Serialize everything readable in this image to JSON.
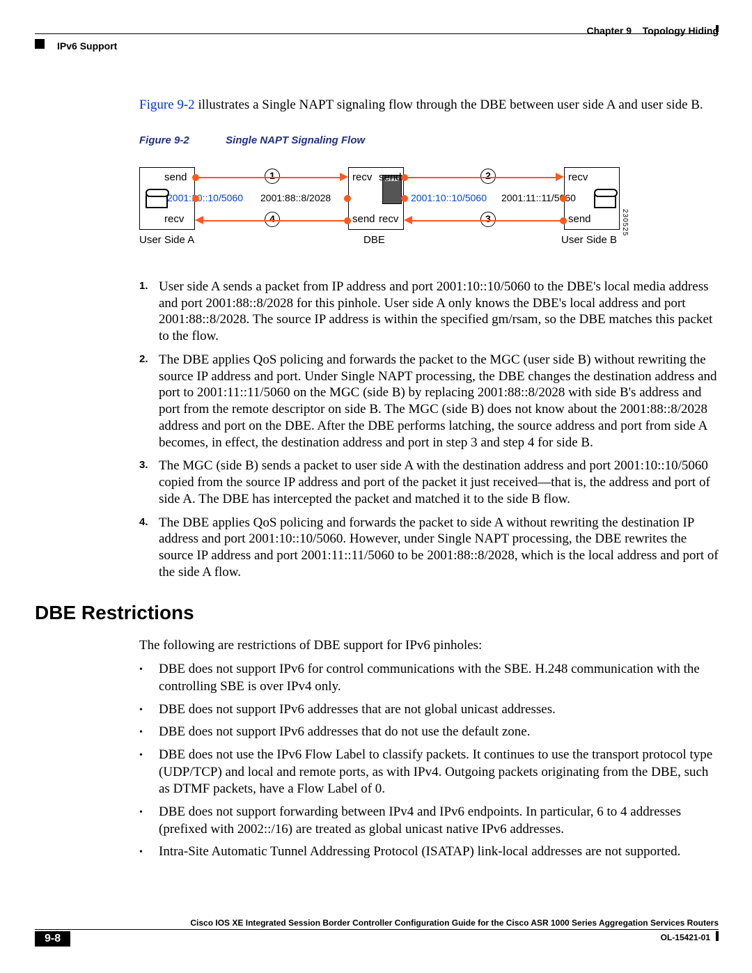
{
  "header": {
    "chapter": "Chapter 9",
    "title": "Topology Hiding",
    "section": "IPv6 Support"
  },
  "intro": {
    "ref": "Figure 9-2",
    "text_after": " illustrates a Single NAPT signaling flow through the DBE between user side A and user side B."
  },
  "figure": {
    "num": "Figure 9-2",
    "title": "Single NAPT Signaling Flow",
    "labels": {
      "send": "send",
      "recv": "recv",
      "userA": "User Side A",
      "dbe": "DBE",
      "userB": "User Side B",
      "addrA": "2001:10::10/5060",
      "addrDBE": "2001:88::8/2028",
      "addrA2": "2001:10::10/5060",
      "addrB": "2001:11::11/5060",
      "imgid": "230525"
    }
  },
  "steps": [
    "User side A sends a packet from IP address and port 2001:10::10/5060 to the DBE's local media address and port 2001:88::8/2028 for this pinhole. User side A only knows the DBE's local address and port 2001:88::8/2028. The source IP address is within the specified gm/rsam, so the DBE matches this packet to the flow.",
    "The DBE applies QoS policing and forwards the packet to the MGC (user side B) without rewriting the source IP address and port. Under Single NAPT processing, the DBE changes the destination address and port to 2001:11::11/5060 on the MGC (side B) by replacing 2001:88::8/2028 with side B's address and port from the remote descriptor on side B. The MGC (side B) does not know about the 2001:88::8/2028 address and port on the DBE. After the DBE performs latching, the source address and port from side A becomes, in effect, the destination address and port in step 3 and step 4 for side B.",
    "The MGC (side B) sends a packet to user side A with the destination address and port 2001:10::10/5060 copied from the source IP address and port of the packet it just received—that is, the address and port of side A. The DBE has intercepted the packet and matched it to the side B flow.",
    "The DBE applies QoS policing and forwards the packet to side A without rewriting the destination IP address and port 2001:10::10/5060. However, under Single NAPT processing, the DBE rewrites the source IP address and port 2001:11::11/5060 to be 2001:88::8/2028, which is the local address and port of the side A flow."
  ],
  "section2": {
    "title": "DBE Restrictions",
    "intro": "The following are restrictions of DBE support for IPv6 pinholes:",
    "bullets": [
      "DBE does not support IPv6 for control communications with the SBE. H.248 communication with the controlling SBE is over IPv4 only.",
      "DBE does not support IPv6 addresses that are not global unicast addresses.",
      "DBE does not support IPv6 addresses that do not use the default zone.",
      "DBE does not use the IPv6 Flow Label to classify packets. It continues to use the transport protocol type (UDP/TCP) and local and remote ports, as with IPv4. Outgoing packets originating from the DBE, such as DTMF packets, have a Flow Label of 0.",
      "DBE does not support forwarding between IPv4 and IPv6 endpoints. In particular, 6 to 4 addresses (prefixed with 2002::/16) are treated as global unicast native IPv6 addresses.",
      "Intra-Site Automatic Tunnel Addressing Protocol (ISATAP) link-local addresses are not supported."
    ]
  },
  "footer": {
    "doc_title": "Cisco IOS XE Integrated Session Border Controller Configuration Guide for the Cisco ASR 1000 Series Aggregation Services Routers",
    "page": "9-8",
    "doc_id": "OL-15421-01"
  }
}
